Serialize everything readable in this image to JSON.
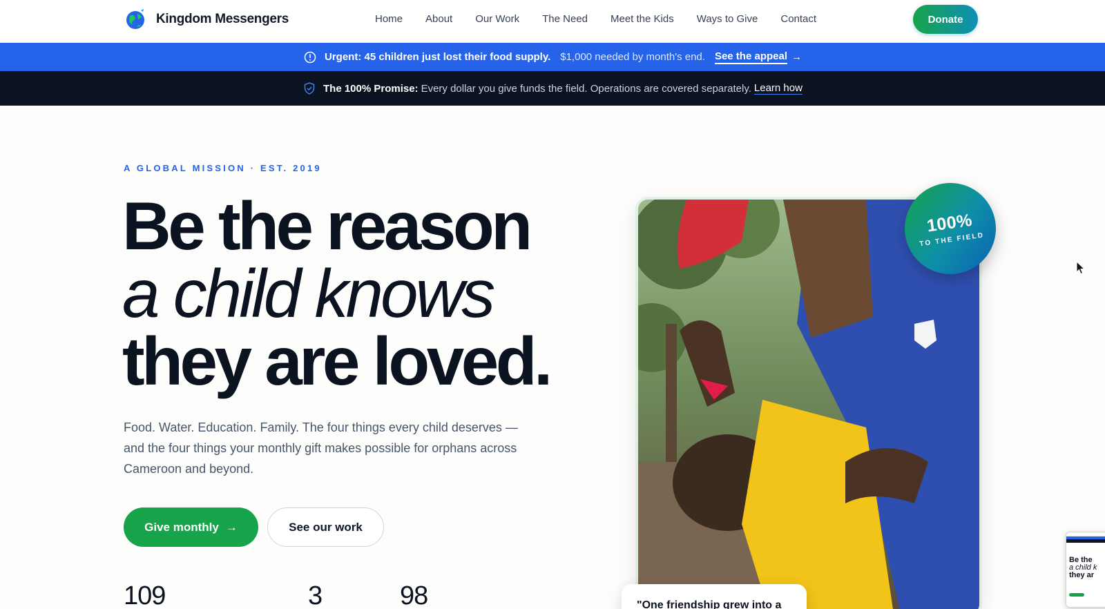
{
  "brand": {
    "name": "Kingdom Messengers"
  },
  "nav": {
    "links": [
      "Home",
      "About",
      "Our Work",
      "The Need",
      "Meet the Kids",
      "Ways to Give",
      "Contact"
    ],
    "donate_label": "Donate"
  },
  "urgent_bar": {
    "headline": "Urgent: 45 children just lost their food supply.",
    "detail": "$1,000 needed by month's end.",
    "link_label": "See the appeal",
    "arrow": "→"
  },
  "promise_bar": {
    "label": "The 100% Promise:",
    "text": "Every dollar you give funds the field. Operations are covered separately.",
    "link_label": "Learn how"
  },
  "hero": {
    "eyebrow": "A GLOBAL MISSION · EST. 2019",
    "headline_line1": "Be the reason",
    "headline_line2": "a child knows",
    "headline_line3": "they are loved.",
    "subcopy": "Food. Water. Education. Family. The four things every child deserves — and the four things your monthly gift makes possible for orphans across Cameroon and beyond.",
    "primary_cta": "Give monthly",
    "primary_arrow": "→",
    "secondary_cta": "See our work",
    "stats": [
      "109",
      "3",
      "98"
    ]
  },
  "photo": {
    "badge_big": "100%",
    "badge_small": "TO THE FIELD",
    "quote": "\"One friendship grew into a"
  },
  "thumbnail": {
    "line1": "Be the",
    "line2": "a child k",
    "line3": "they ar"
  },
  "colors": {
    "accent_blue": "#2563eb",
    "accent_green": "#16a34a",
    "dark_bar": "#0b1220",
    "badge_teal": "#0e8fa8"
  }
}
